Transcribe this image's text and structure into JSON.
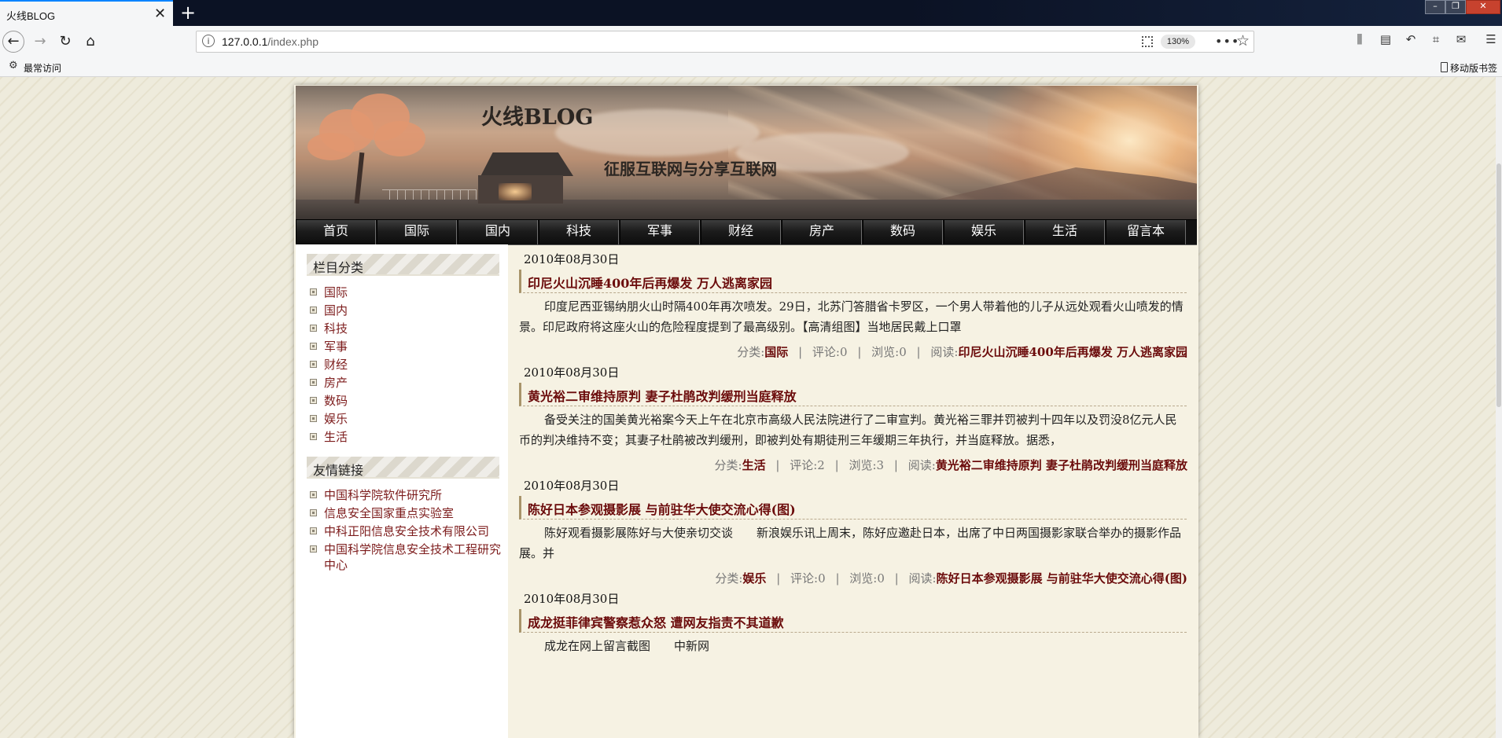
{
  "browser": {
    "tab_title": "火线BLOG",
    "tab_close": "✕",
    "new_tab": "+",
    "url_host": "127.0.0.1",
    "url_path": "/index.php",
    "zoom": "130%",
    "bookmark_label": "最常访问",
    "mobile_bookmarks": "移动版书签"
  },
  "site": {
    "title": "火线BLOG",
    "slogan": "征服互联网与分享互联网"
  },
  "menu": [
    "首页",
    "国际",
    "国内",
    "科技",
    "军事",
    "财经",
    "房产",
    "数码",
    "娱乐",
    "生活",
    "留言本"
  ],
  "sidebar": {
    "categories_title": "栏目分类",
    "categories": [
      "国际",
      "国内",
      "科技",
      "军事",
      "财经",
      "房产",
      "数码",
      "娱乐",
      "生活"
    ],
    "links_title": "友情链接",
    "links": [
      "中国科学院软件研究所",
      "信息安全国家重点实验室",
      "中科正阳信息安全技术有限公司",
      "中国科学院信息安全技术工程研究中心"
    ]
  },
  "labels": {
    "category": "分类:",
    "comments": "评论:",
    "views": "浏览:",
    "read": "阅读:",
    "sep": "|"
  },
  "posts": [
    {
      "date": "2010年08月30日",
      "title": "印尼火山沉睡400年后再爆发 万人逃离家园",
      "body": "印度尼西亚锡纳朋火山时隔400年再次喷发。29日，北苏门答腊省卡罗区，一个男人带着他的儿子从远处观看火山喷发的情景。印尼政府将这座火山的危险程度提到了最高级别。【高清组图】当地居民戴上口罩",
      "category": "国际",
      "comments": "0",
      "views": "0",
      "read": "印尼火山沉睡400年后再爆发 万人逃离家园"
    },
    {
      "date": "2010年08月30日",
      "title": "黄光裕二审维持原判 妻子杜鹃改判缓刑当庭释放",
      "body": "备受关注的国美黄光裕案今天上午在北京市高级人民法院进行了二审宣判。黄光裕三罪并罚被判十四年以及罚没8亿元人民币的判决维持不变；其妻子杜鹃被改判缓刑，即被判处有期徒刑三年缓期三年执行，并当庭释放。据悉，",
      "category": "生活",
      "comments": "2",
      "views": "3",
      "read": "黄光裕二审维持原判 妻子杜鹃改判缓刑当庭释放"
    },
    {
      "date": "2010年08月30日",
      "title": "陈好日本参观摄影展 与前驻华大使交流心得(图)",
      "body": "陈好观看摄影展陈好与大使亲切交谈　　新浪娱乐讯上周末，陈好应邀赴日本，出席了中日两国摄影家联合举办的摄影作品展。并",
      "category": "娱乐",
      "comments": "0",
      "views": "0",
      "read": "陈好日本参观摄影展 与前驻华大使交流心得(图)"
    },
    {
      "date": "2010年08月30日",
      "title": "成龙挺菲律宾警察惹众怒 遭网友指责不其道歉",
      "body": "成龙在网上留言截图　　中新网"
    }
  ]
}
